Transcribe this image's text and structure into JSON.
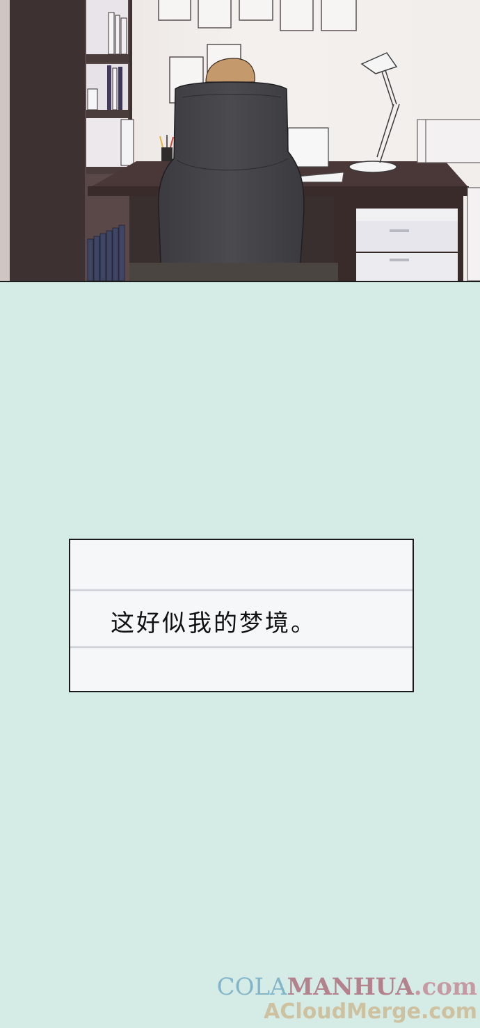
{
  "caption": {
    "text": "这好似我的梦境。"
  },
  "watermark": {
    "line1_part1": "COLA",
    "line1_part2": "MANHUA",
    "line1_part3": ".com",
    "line2": "ACloudMerge.com"
  },
  "colors": {
    "background": "#d5ebe6",
    "caption_box": "#f6f7f9",
    "border": "#1a1a1a"
  }
}
